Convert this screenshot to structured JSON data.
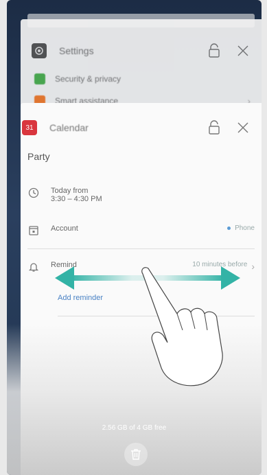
{
  "settings_card": {
    "app_name": "Settings",
    "items": [
      {
        "label": "Security & privacy",
        "color": "#4caf50"
      },
      {
        "label": "Smart assistance",
        "color": "#f07b2e"
      }
    ]
  },
  "calendar_card": {
    "app_name": "Calendar",
    "icon_text": "31",
    "event_title": "Party",
    "time_line1": "Today from",
    "time_line2": "3:30 – 4:30 PM",
    "account_label": "Account",
    "account_value": "Phone",
    "remind_label": "Remind",
    "remind_value": "10 minutes before",
    "add_reminder": "Add reminder"
  },
  "storage_text": "2.56 GB of 4 GB free",
  "colors": {
    "calendar_icon": "#d9363e",
    "arrow": "#33b3a6",
    "link": "#4a82c4"
  },
  "icons": {
    "settings": "gear-icon",
    "lock": "lock-icon",
    "close": "close-icon",
    "clock": "clock-icon",
    "account": "calendar-account-icon",
    "bell": "bell-icon",
    "trash": "trash-icon",
    "swipe": "swipe-hand-icon"
  }
}
